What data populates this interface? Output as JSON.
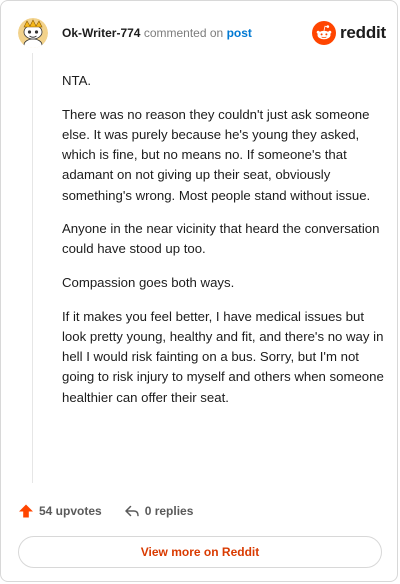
{
  "header": {
    "username": "Ok-Writer-774",
    "commented_text": "commented on",
    "post_link": "post",
    "brand": "reddit",
    "avatar_icon": "snoo-avatar-icon",
    "brand_icon": "reddit-logo-icon"
  },
  "comment": {
    "paragraphs": [
      "NTA.",
      "There was no reason they couldn't just ask someone else. It was purely because he's young they asked, which is fine, but no means no. If someone's that adamant on not giving up their seat, obviously something's wrong. Most people stand without issue.",
      "Anyone in the near vicinity that heard the conversation could have stood up too.",
      "Compassion goes both ways.",
      "If it makes you feel better, I have medical issues but look pretty young, healthy and fit, and there's no way in hell I would risk fainting on a bus. Sorry, but I'm not going to risk injury to myself and others when someone healthier can offer their seat."
    ]
  },
  "actions": {
    "upvotes": "54 upvotes",
    "replies": "0 replies",
    "upvote_icon": "upvote-arrow-icon",
    "reply_icon": "reply-arrow-icon"
  },
  "footer": {
    "view_more": "View more on Reddit"
  },
  "colors": {
    "brand_orange": "#ff4500",
    "link_blue": "#0079d3",
    "view_more_red": "#d93a00"
  }
}
